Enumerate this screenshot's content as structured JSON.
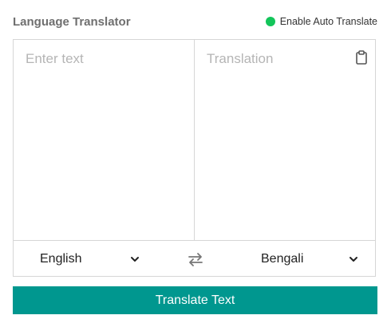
{
  "header": {
    "title": "Language Translator",
    "auto_translate": {
      "label": "Enable Auto Translate",
      "enabled": true,
      "indicator_color": "#13c55a"
    }
  },
  "source": {
    "placeholder": "Enter text",
    "value": ""
  },
  "target": {
    "placeholder": "Translation",
    "value": "",
    "copy_icon": "clipboard-icon"
  },
  "controls": {
    "from_language": "English",
    "to_language": "Bengali",
    "swap_icon": "swap-arrows-icon"
  },
  "action": {
    "translate_label": "Translate Text",
    "color": "#00978f"
  }
}
